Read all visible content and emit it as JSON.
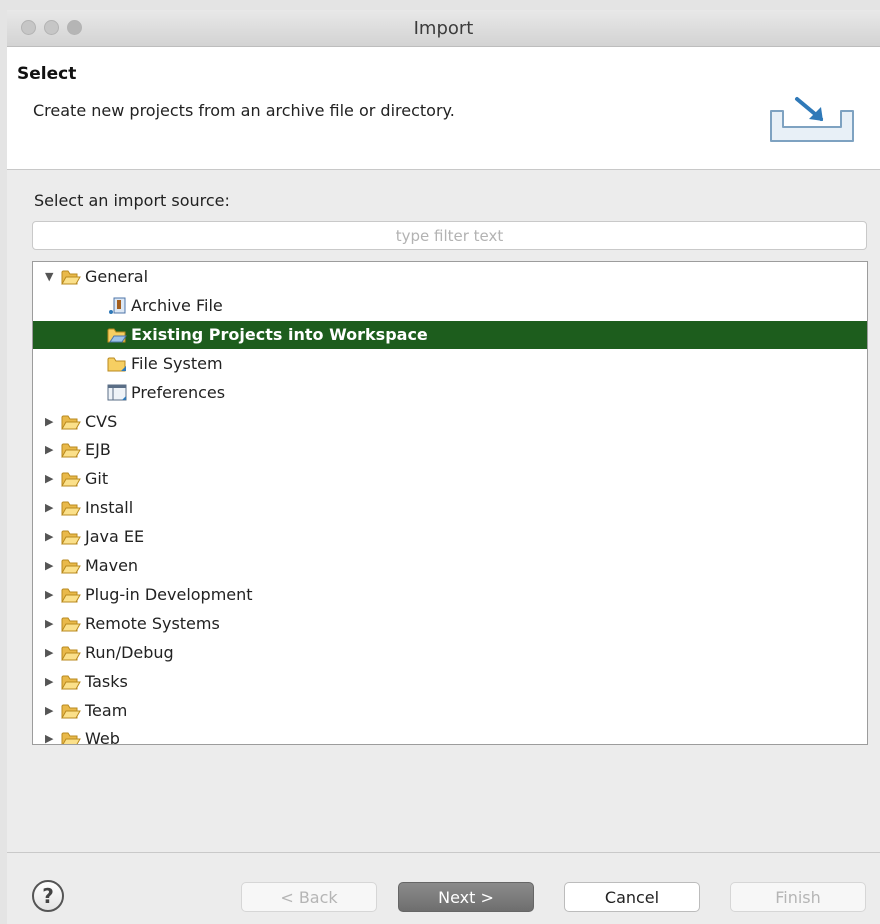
{
  "window": {
    "title": "Import"
  },
  "header": {
    "title": "Select",
    "description": "Create new projects from an archive file or directory.",
    "banner_icon": "import-wizard-icon"
  },
  "section_label": "Select an import source:",
  "filter": {
    "placeholder": "type filter text",
    "value": ""
  },
  "tree": {
    "items": [
      {
        "label": "General",
        "level": 0,
        "expanded": true,
        "icon": "folder-open-icon"
      },
      {
        "label": "Archive File",
        "level": 1,
        "icon": "archive-file-icon"
      },
      {
        "label": "Existing Projects into Workspace",
        "level": 1,
        "icon": "existing-projects-icon",
        "selected": true
      },
      {
        "label": "File System",
        "level": 1,
        "icon": "file-system-icon"
      },
      {
        "label": "Preferences",
        "level": 1,
        "icon": "preferences-icon"
      },
      {
        "label": "CVS",
        "level": 0,
        "expanded": false,
        "icon": "folder-icon"
      },
      {
        "label": "EJB",
        "level": 0,
        "expanded": false,
        "icon": "folder-icon"
      },
      {
        "label": "Git",
        "level": 0,
        "expanded": false,
        "icon": "folder-icon"
      },
      {
        "label": "Install",
        "level": 0,
        "expanded": false,
        "icon": "folder-icon"
      },
      {
        "label": "Java EE",
        "level": 0,
        "expanded": false,
        "icon": "folder-icon"
      },
      {
        "label": "Maven",
        "level": 0,
        "expanded": false,
        "icon": "folder-icon"
      },
      {
        "label": "Plug-in Development",
        "level": 0,
        "expanded": false,
        "icon": "folder-icon"
      },
      {
        "label": "Remote Systems",
        "level": 0,
        "expanded": false,
        "icon": "folder-icon"
      },
      {
        "label": "Run/Debug",
        "level": 0,
        "expanded": false,
        "icon": "folder-icon"
      },
      {
        "label": "Tasks",
        "level": 0,
        "expanded": false,
        "icon": "folder-icon"
      },
      {
        "label": "Team",
        "level": 0,
        "expanded": false,
        "icon": "folder-icon"
      },
      {
        "label": "Web",
        "level": 0,
        "expanded": false,
        "icon": "folder-icon"
      }
    ]
  },
  "buttons": {
    "help_icon": "help-icon",
    "help_glyph": "?",
    "back": "< Back",
    "next": "Next >",
    "cancel": "Cancel",
    "finish": "Finish"
  },
  "colors": {
    "selection": "#1d5d1d",
    "folder": "#f2c14e",
    "default_button": "#7a7a7a"
  }
}
